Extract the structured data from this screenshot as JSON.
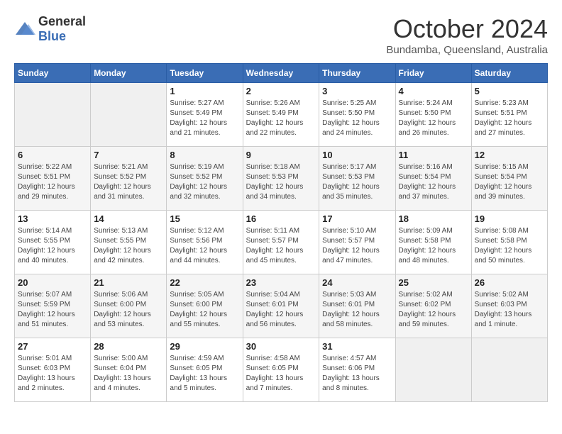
{
  "logo": {
    "general": "General",
    "blue": "Blue"
  },
  "title": "October 2024",
  "subtitle": "Bundamba, Queensland, Australia",
  "days_of_week": [
    "Sunday",
    "Monday",
    "Tuesday",
    "Wednesday",
    "Thursday",
    "Friday",
    "Saturday"
  ],
  "weeks": [
    [
      {
        "day": "",
        "empty": true
      },
      {
        "day": "",
        "empty": true
      },
      {
        "day": "1",
        "sunrise": "5:27 AM",
        "sunset": "5:49 PM",
        "daylight": "12 hours and 21 minutes."
      },
      {
        "day": "2",
        "sunrise": "5:26 AM",
        "sunset": "5:49 PM",
        "daylight": "12 hours and 22 minutes."
      },
      {
        "day": "3",
        "sunrise": "5:25 AM",
        "sunset": "5:50 PM",
        "daylight": "12 hours and 24 minutes."
      },
      {
        "day": "4",
        "sunrise": "5:24 AM",
        "sunset": "5:50 PM",
        "daylight": "12 hours and 26 minutes."
      },
      {
        "day": "5",
        "sunrise": "5:23 AM",
        "sunset": "5:51 PM",
        "daylight": "12 hours and 27 minutes."
      }
    ],
    [
      {
        "day": "6",
        "sunrise": "5:22 AM",
        "sunset": "5:51 PM",
        "daylight": "12 hours and 29 minutes."
      },
      {
        "day": "7",
        "sunrise": "5:21 AM",
        "sunset": "5:52 PM",
        "daylight": "12 hours and 31 minutes."
      },
      {
        "day": "8",
        "sunrise": "5:19 AM",
        "sunset": "5:52 PM",
        "daylight": "12 hours and 32 minutes."
      },
      {
        "day": "9",
        "sunrise": "5:18 AM",
        "sunset": "5:53 PM",
        "daylight": "12 hours and 34 minutes."
      },
      {
        "day": "10",
        "sunrise": "5:17 AM",
        "sunset": "5:53 PM",
        "daylight": "12 hours and 35 minutes."
      },
      {
        "day": "11",
        "sunrise": "5:16 AM",
        "sunset": "5:54 PM",
        "daylight": "12 hours and 37 minutes."
      },
      {
        "day": "12",
        "sunrise": "5:15 AM",
        "sunset": "5:54 PM",
        "daylight": "12 hours and 39 minutes."
      }
    ],
    [
      {
        "day": "13",
        "sunrise": "5:14 AM",
        "sunset": "5:55 PM",
        "daylight": "12 hours and 40 minutes."
      },
      {
        "day": "14",
        "sunrise": "5:13 AM",
        "sunset": "5:55 PM",
        "daylight": "12 hours and 42 minutes."
      },
      {
        "day": "15",
        "sunrise": "5:12 AM",
        "sunset": "5:56 PM",
        "daylight": "12 hours and 44 minutes."
      },
      {
        "day": "16",
        "sunrise": "5:11 AM",
        "sunset": "5:57 PM",
        "daylight": "12 hours and 45 minutes."
      },
      {
        "day": "17",
        "sunrise": "5:10 AM",
        "sunset": "5:57 PM",
        "daylight": "12 hours and 47 minutes."
      },
      {
        "day": "18",
        "sunrise": "5:09 AM",
        "sunset": "5:58 PM",
        "daylight": "12 hours and 48 minutes."
      },
      {
        "day": "19",
        "sunrise": "5:08 AM",
        "sunset": "5:58 PM",
        "daylight": "12 hours and 50 minutes."
      }
    ],
    [
      {
        "day": "20",
        "sunrise": "5:07 AM",
        "sunset": "5:59 PM",
        "daylight": "12 hours and 51 minutes."
      },
      {
        "day": "21",
        "sunrise": "5:06 AM",
        "sunset": "6:00 PM",
        "daylight": "12 hours and 53 minutes."
      },
      {
        "day": "22",
        "sunrise": "5:05 AM",
        "sunset": "6:00 PM",
        "daylight": "12 hours and 55 minutes."
      },
      {
        "day": "23",
        "sunrise": "5:04 AM",
        "sunset": "6:01 PM",
        "daylight": "12 hours and 56 minutes."
      },
      {
        "day": "24",
        "sunrise": "5:03 AM",
        "sunset": "6:01 PM",
        "daylight": "12 hours and 58 minutes."
      },
      {
        "day": "25",
        "sunrise": "5:02 AM",
        "sunset": "6:02 PM",
        "daylight": "12 hours and 59 minutes."
      },
      {
        "day": "26",
        "sunrise": "5:02 AM",
        "sunset": "6:03 PM",
        "daylight": "13 hours and 1 minute."
      }
    ],
    [
      {
        "day": "27",
        "sunrise": "5:01 AM",
        "sunset": "6:03 PM",
        "daylight": "13 hours and 2 minutes."
      },
      {
        "day": "28",
        "sunrise": "5:00 AM",
        "sunset": "6:04 PM",
        "daylight": "13 hours and 4 minutes."
      },
      {
        "day": "29",
        "sunrise": "4:59 AM",
        "sunset": "6:05 PM",
        "daylight": "13 hours and 5 minutes."
      },
      {
        "day": "30",
        "sunrise": "4:58 AM",
        "sunset": "6:05 PM",
        "daylight": "13 hours and 7 minutes."
      },
      {
        "day": "31",
        "sunrise": "4:57 AM",
        "sunset": "6:06 PM",
        "daylight": "13 hours and 8 minutes."
      },
      {
        "day": "",
        "empty": true
      },
      {
        "day": "",
        "empty": true
      }
    ]
  ]
}
